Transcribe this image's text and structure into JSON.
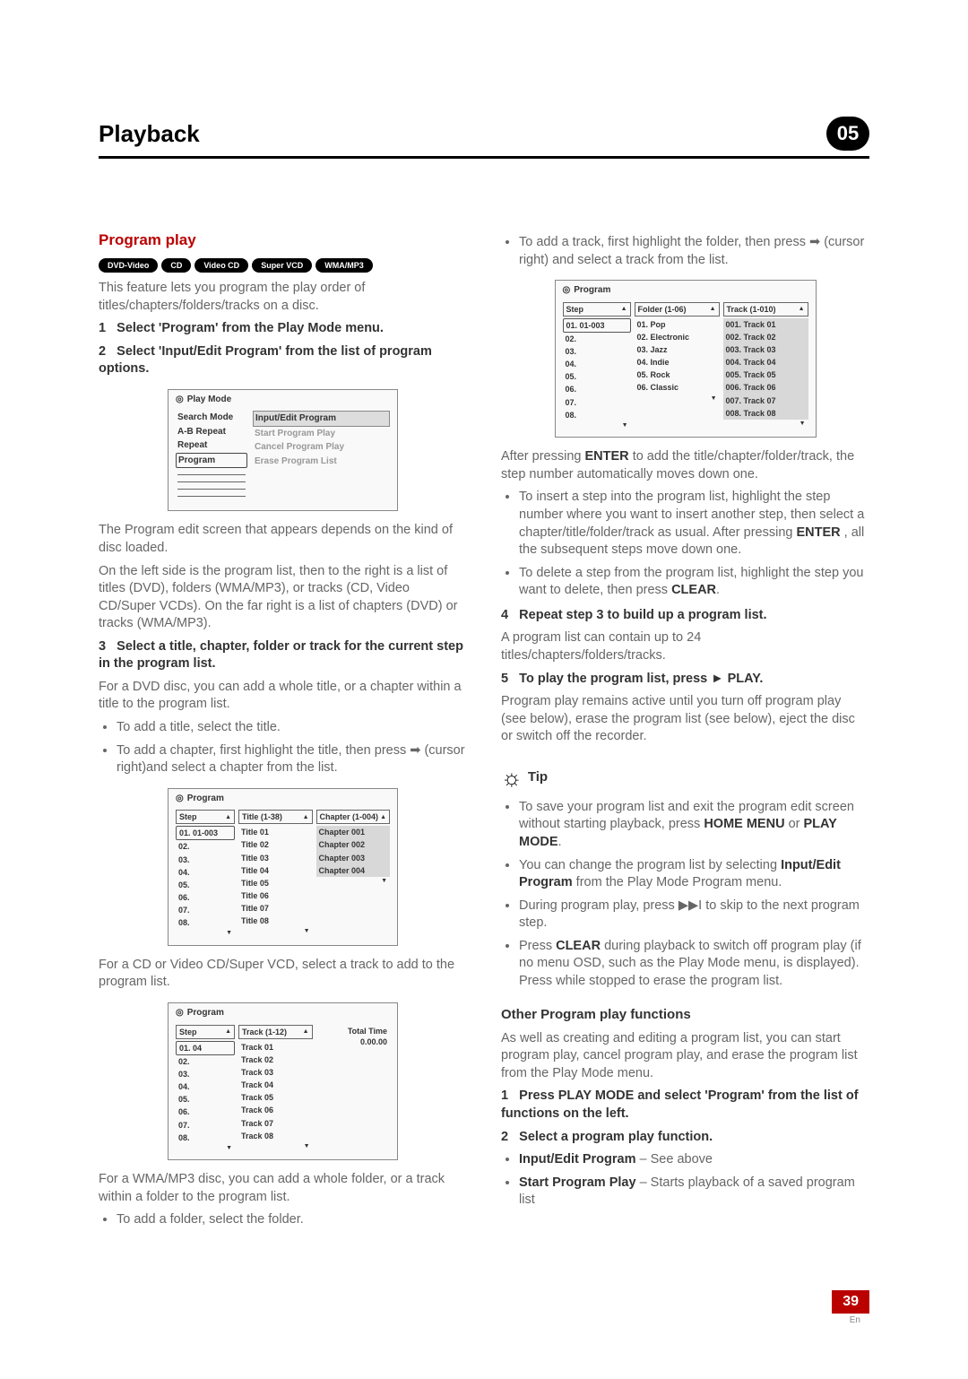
{
  "header": {
    "title": "Playback",
    "chapter": "05"
  },
  "section_heading": "Program play",
  "pills": [
    "DVD-Video",
    "CD",
    "Video CD",
    "Super VCD",
    "WMA/MP3"
  ],
  "intro": "This feature lets you program the play order of titles/chapters/folders/tracks on a disc.",
  "step1": {
    "num": "1",
    "text": "Select 'Program' from the Play Mode menu."
  },
  "step2": {
    "num": "2",
    "text": "Select 'Input/Edit Program' from the list of program options."
  },
  "playmode_box": {
    "title": "Play Mode",
    "left": [
      "Search Mode",
      "A-B Repeat",
      "Repeat",
      "Program"
    ],
    "right": [
      "Input/Edit Program",
      "Start Program Play",
      "Cancel Program Play",
      "Erase Program List"
    ]
  },
  "after_pm": "The Program edit screen that appears depends on the kind of disc loaded.",
  "after_pm2": "On the left side is the program list, then to the right is a list of titles (DVD), folders (WMA/MP3), or tracks (CD, Video CD/Super VCDs). On the far right is a list of chapters (DVD) or tracks (WMA/MP3).",
  "step3": {
    "num": "3",
    "text": "Select a title, chapter, folder or track for the current step in the program list."
  },
  "step3_after": "For a DVD disc, you can add a whole title, or a chapter within a title to the program list.",
  "step3_b1": "To add a title, select the title.",
  "step3_b2_a": "To add a chapter, first highlight the title, then press ",
  "step3_b2_arrow": "➡",
  "step3_b2_b": " (cursor right)and select a chapter from the list.",
  "prog_dvd": {
    "title": "Program",
    "h1": "Step",
    "h2": "Title (1-38)",
    "h3": "Chapter (1-004)",
    "steps": [
      "01. 01-003",
      "02.",
      "03.",
      "04.",
      "05.",
      "06.",
      "07.",
      "08."
    ],
    "titles": [
      "Title 01",
      "Title 02",
      "Title 03",
      "Title 04",
      "Title 05",
      "Title 06",
      "Title 07",
      "Title 08"
    ],
    "chapters": [
      "Chapter 001",
      "Chapter 002",
      "Chapter 003",
      "Chapter 004"
    ]
  },
  "cd_text": "For a CD or Video CD/Super VCD, select a track to add to the program list.",
  "prog_cd": {
    "title": "Program",
    "h1": "Step",
    "h2": "Track (1-12)",
    "total": "Total Time 0.00.00",
    "steps": [
      "01. 04",
      "02.",
      "03.",
      "04.",
      "05.",
      "06.",
      "07.",
      "08."
    ],
    "tracks": [
      "Track 01",
      "Track 02",
      "Track 03",
      "Track 04",
      "Track 05",
      "Track 06",
      "Track 07",
      "Track 08"
    ]
  },
  "wma_text": "For a WMA/MP3 disc, you can add a whole folder, or a track within a folder to the program list.",
  "wma_b1": "To add a folder, select the folder.",
  "col2_b1_a": "To add a track, first highlight the folder, then press ",
  "col2_b1_arrow": "➡",
  "col2_b1_b": " (cursor right) and select a track from the list.",
  "prog_wma": {
    "title": "Program",
    "h1": "Step",
    "h2": "Folder (1-06)",
    "h3": "Track (1-010)",
    "steps": [
      "01. 01-003",
      "02.",
      "03.",
      "04.",
      "05.",
      "06.",
      "07.",
      "08."
    ],
    "folders": [
      "01. Pop",
      "02. Electronic",
      "03. Jazz",
      "04. Indie",
      "05. Rock",
      "06. Classic"
    ],
    "tracks": [
      "001. Track 01",
      "002. Track 02",
      "003. Track 03",
      "004. Track 04",
      "005. Track 05",
      "006. Track 06",
      "007. Track 07",
      "008. Track 08"
    ]
  },
  "after_enter_a": "After pressing ",
  "enter_key": "ENTER",
  "after_enter_b": " to add the title/chapter/folder/track, the step number automatically moves down one.",
  "sub_b1_a": "To insert a step into the program list, highlight the step number where you want to insert another step, then select a chapter/title/folder/track as usual. After pressing ",
  "sub_b1_b": ", all the subsequent steps move down one.",
  "sub_b2_a": "To delete a step from the program list, highlight the step you want to delete, then press ",
  "clear_key": "CLEAR",
  "step4": {
    "num": "4",
    "text": "Repeat step 3 to build up a program list."
  },
  "step4_after": "A program list can contain up to 24 titles/chapters/folders/tracks.",
  "step5": {
    "num": "5",
    "text_a": "To play the program list, press ",
    "glyph": "►",
    "text_b": " PLAY."
  },
  "step5_after": "Program play remains active until you turn off program play (see below), erase the program list (see below), eject the disc or switch off the recorder.",
  "tip_label": "Tip",
  "tip_b1_a": "To save your program list and exit the program edit screen without starting playback, press ",
  "tip_b1_key1": "HOME MENU",
  "tip_b1_or": " or ",
  "tip_b1_key2": "PLAY MODE",
  "tip_b2_a": "You can change the program list by selecting ",
  "tip_b2_key": "Input/Edit Program",
  "tip_b2_b": " from the Play Mode Program menu.",
  "tip_b3_a": "During program play, press ",
  "tip_b3_glyph": "▶▶I",
  "tip_b3_b": " to skip to the next program step.",
  "tip_b4_a": "Press ",
  "tip_b4_b": " during playback to switch off program play (if no menu OSD, such as the Play Mode menu, is displayed). Press while stopped to erase the program list.",
  "other_heading": "Other Program play functions",
  "other_intro": "As well as creating and editing a program list, you can start program play, cancel program play, and erase the program list from the Play Mode menu.",
  "ostep1": {
    "num": "1",
    "text": "Press PLAY MODE and select 'Program' from the list of functions on the left."
  },
  "ostep2": {
    "num": "2",
    "text": "Select a program play function."
  },
  "ostep2_b1_key": "Input/Edit Program",
  "ostep2_b1_t": " – See above",
  "ostep2_b2_key": "Start Program Play",
  "ostep2_b2_t": " – Starts playback of a saved program list",
  "footer": {
    "page": "39",
    "lang": "En"
  }
}
